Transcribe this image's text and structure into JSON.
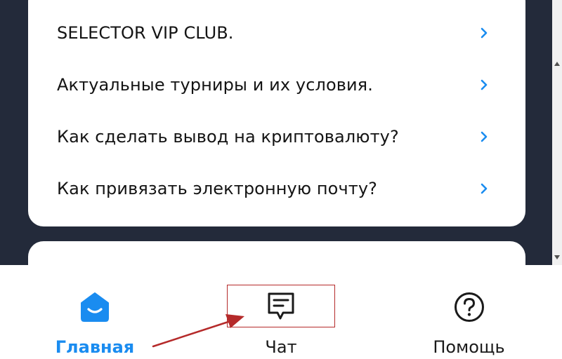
{
  "faq": {
    "items": [
      {
        "label": "SELECTOR VIP CLUB."
      },
      {
        "label": "Актуальные турниры и их условия."
      },
      {
        "label": "Как сделать вывод на криптовалюту?"
      },
      {
        "label": "Как привязать электронную почту?"
      }
    ]
  },
  "nav": {
    "home": {
      "label": "Главная",
      "icon": "home-icon"
    },
    "chat": {
      "label": "Чат",
      "icon": "chat-icon"
    },
    "help": {
      "label": "Помощь",
      "icon": "help-icon"
    }
  },
  "colors": {
    "background": "#232a3a",
    "card": "#ffffff",
    "accent": "#1a8cf0",
    "annotation": "#b52a2a"
  }
}
